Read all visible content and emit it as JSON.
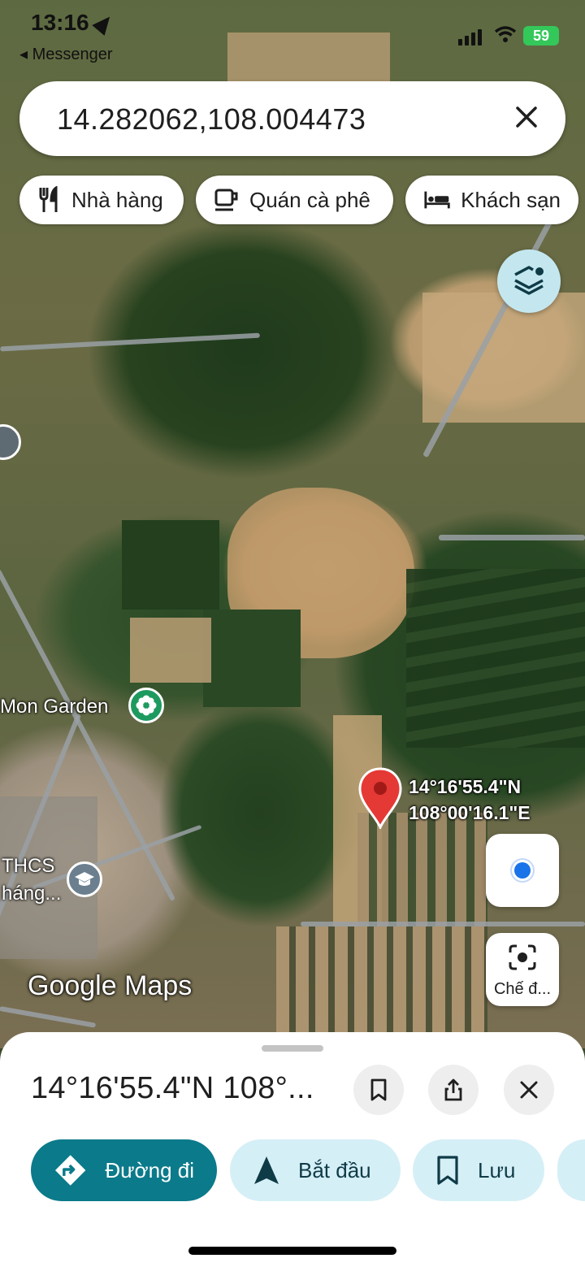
{
  "status_bar": {
    "time": "13:16",
    "back_app": "Messenger",
    "battery": "59"
  },
  "search": {
    "value": "14.282062,108.004473"
  },
  "chips": [
    "Nhà hàng",
    "Quán cà phê",
    "Khách sạn"
  ],
  "map": {
    "pin_label_lat": "14°16'55.4\"N",
    "pin_label_lng": "108°00'16.1\"E",
    "poi_garden": "Mon Garden",
    "poi_school_line1": "THCS",
    "poi_school_line2": "háng...",
    "watermark": "Google Maps",
    "lens_label": "Chế đ..."
  },
  "sheet": {
    "title": "14°16'55.4\"N 108°...",
    "buttons": [
      "Đường đi",
      "Bắt đầu",
      "Lưu"
    ]
  },
  "colors": {
    "accent": "#0b7a8a",
    "light_chip": "#d5eff6",
    "pin": "#e53935"
  }
}
